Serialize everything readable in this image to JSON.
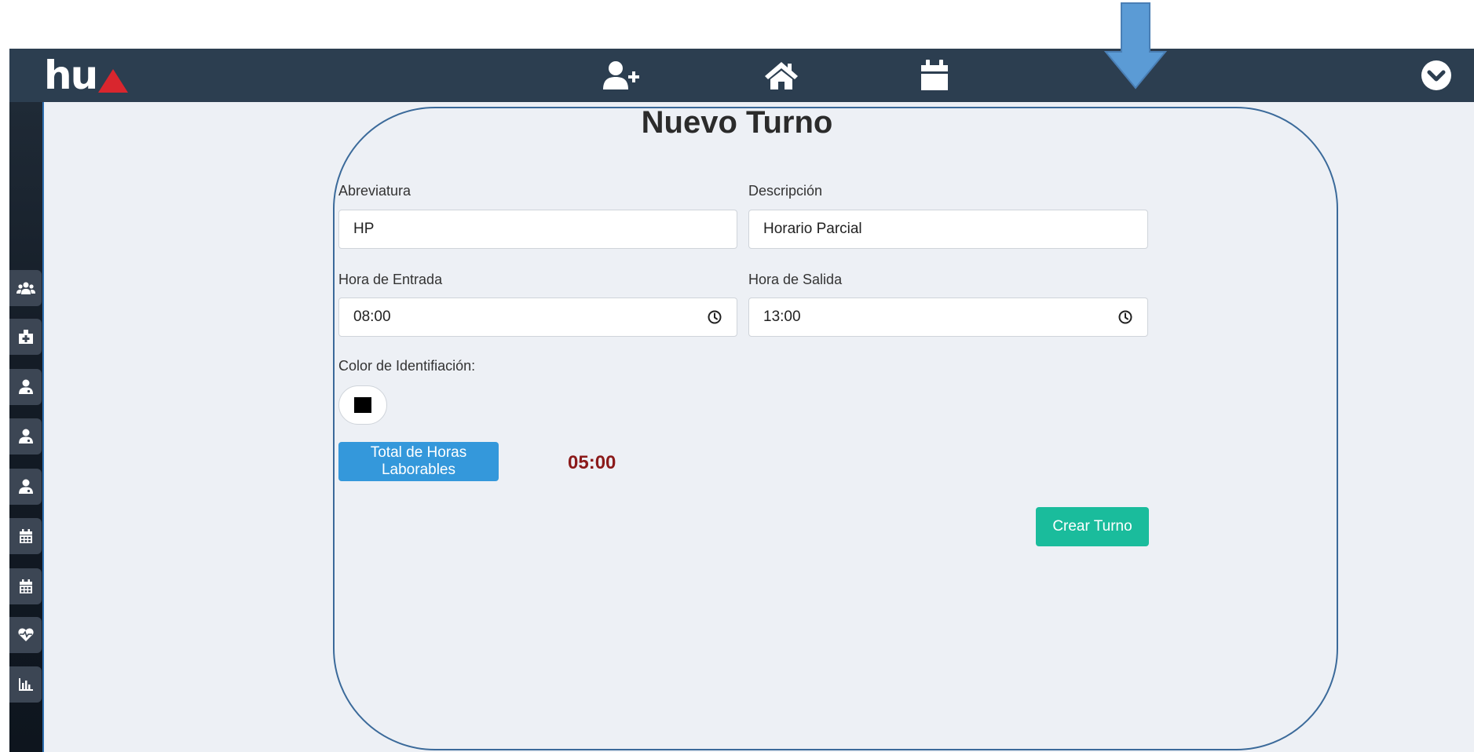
{
  "brand": {
    "logo_text": "hu"
  },
  "navbar": {
    "icons": [
      "add-user-icon",
      "home-icon",
      "calendar-icon",
      "chevron-down-circle-icon"
    ]
  },
  "sidebar": {
    "items": [
      {
        "icon": "users-icon"
      },
      {
        "icon": "hospital-icon"
      },
      {
        "icon": "user-doctor-icon"
      },
      {
        "icon": "user-doctor-icon"
      },
      {
        "icon": "user-doctor-icon"
      },
      {
        "icon": "calendar-icon"
      },
      {
        "icon": "calendar-icon"
      },
      {
        "icon": "heartbeat-icon"
      },
      {
        "icon": "chart-bar-icon"
      }
    ]
  },
  "form": {
    "title": "Nuevo Turno",
    "abbreviation": {
      "label": "Abreviatura",
      "value": "HP"
    },
    "description": {
      "label": "Descripción",
      "value": "Horario Parcial"
    },
    "entry_time": {
      "label": "Hora de Entrada",
      "value": "08:00"
    },
    "exit_time": {
      "label": "Hora de Salida",
      "value": "13:00"
    },
    "color": {
      "label": "Color de Identifiación:",
      "value": "#000000"
    },
    "total_hours": {
      "button_label": "Total de Horas Laborables",
      "value": "05:00"
    },
    "submit_label": "Crear Turno"
  },
  "colors": {
    "navbar": "#2c3e50",
    "primary_button": "#3498db",
    "success_button": "#1abc9c",
    "total_value": "#8b1a1a",
    "annotation_arrow": "#5b9bd5",
    "card_outline": "#3b6a9a"
  }
}
